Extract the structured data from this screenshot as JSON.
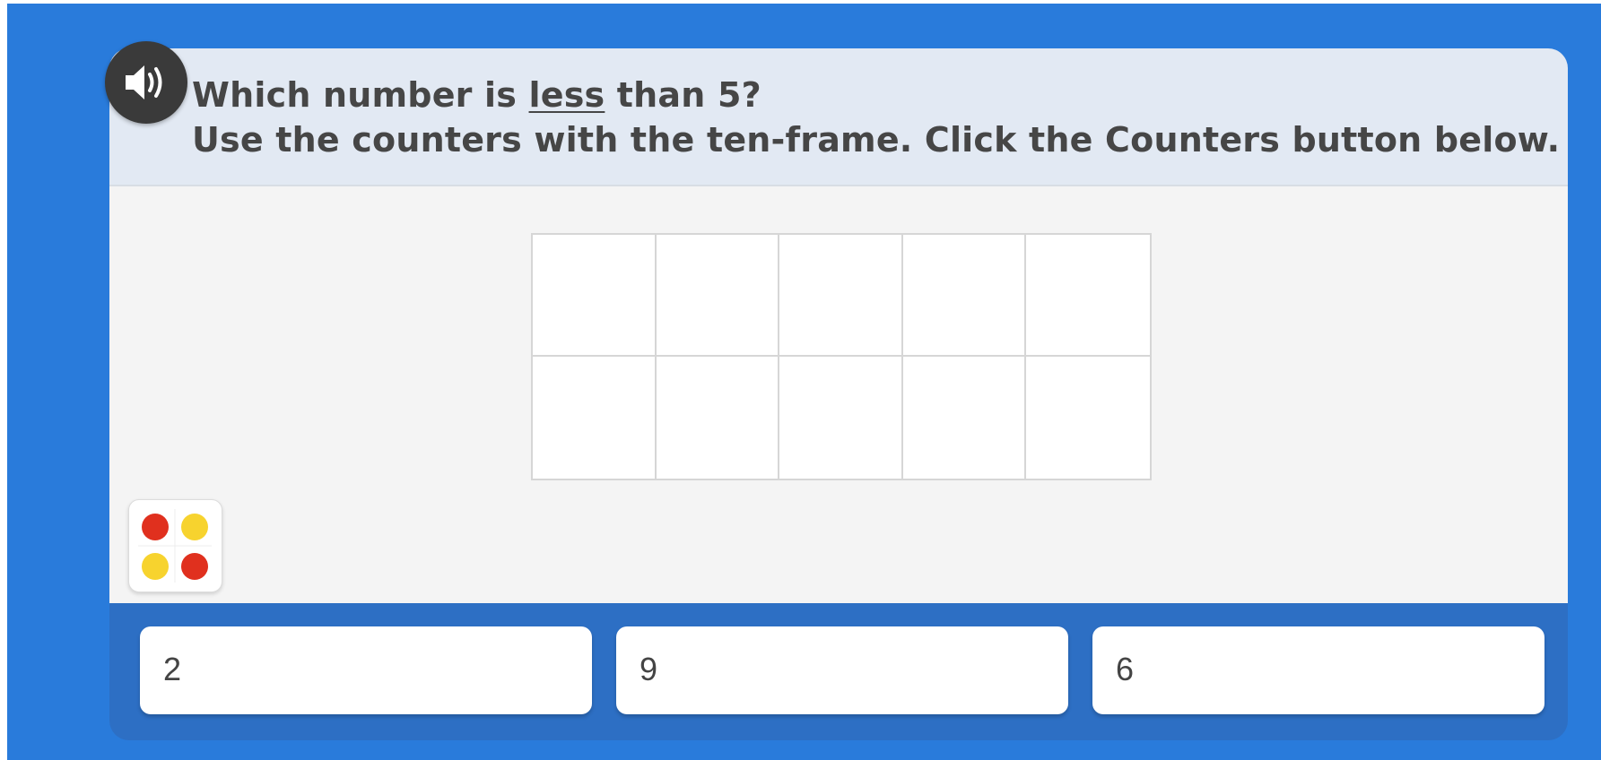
{
  "question": {
    "line1_before": "Which number is ",
    "line1_emphasis": "less",
    "line1_after": " than 5?",
    "line2": "Use the counters with the ten-frame. Click the Counters button below."
  },
  "audio_button": {
    "icon": "speaker-icon"
  },
  "ten_frame": {
    "rows": 2,
    "columns": 5,
    "filled_cells": 0
  },
  "counters_button": {
    "icon": "counters-icon",
    "counter_colors": [
      "#e0301e",
      "#f7d32e",
      "#f7d32e",
      "#e0301e"
    ]
  },
  "answers": [
    {
      "label": "2"
    },
    {
      "label": "9"
    },
    {
      "label": "6"
    }
  ],
  "colors": {
    "background_blue": "#297bdb",
    "answer_bar_blue": "#2d6fc4",
    "prompt_background": "#e2e9f3",
    "work_background": "#f4f4f4",
    "counter_red": "#e0301e",
    "counter_yellow": "#f7d32e"
  }
}
